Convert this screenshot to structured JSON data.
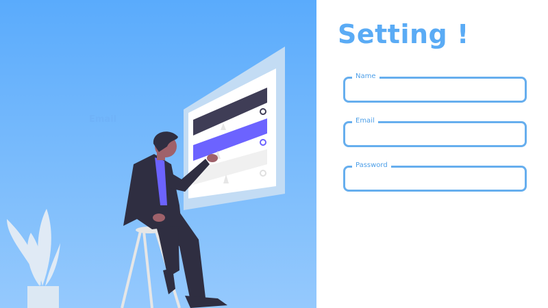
{
  "illustration": {
    "ghost_label": "Email"
  },
  "form": {
    "title": "Setting !",
    "fields": [
      {
        "label": "Name",
        "value": "",
        "type": "text"
      },
      {
        "label": "Email",
        "value": "",
        "type": "email"
      },
      {
        "label": "Password",
        "value": "",
        "type": "password"
      }
    ]
  },
  "colors": {
    "accent": "#5aabf5",
    "hero_bg": "#5aabfc",
    "field_border": "#66aeee"
  }
}
